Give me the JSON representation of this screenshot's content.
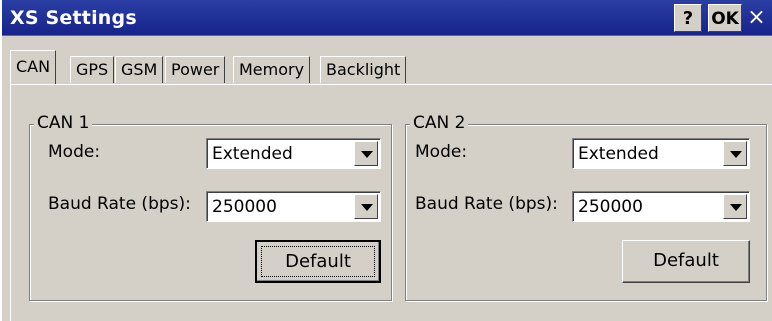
{
  "window": {
    "title": "XS Settings",
    "help_label": "?",
    "ok_label": "OK",
    "close_label": "×"
  },
  "tabs": [
    {
      "label": "CAN",
      "active": true
    },
    {
      "label": "GPS",
      "active": false
    },
    {
      "label": "GSM",
      "active": false
    },
    {
      "label": "Power",
      "active": false
    },
    {
      "label": "Memory",
      "active": false
    },
    {
      "label": "Backlight",
      "active": false
    }
  ],
  "can1": {
    "group_label": "CAN 1",
    "mode_label": "Mode:",
    "mode_value": "Extended",
    "baud_label": "Baud Rate (bps):",
    "baud_value": "250000",
    "default_label": "Default"
  },
  "can2": {
    "group_label": "CAN 2",
    "mode_label": "Mode:",
    "mode_value": "Extended",
    "baud_label": "Baud Rate (bps):",
    "baud_value": "250000",
    "default_label": "Default"
  },
  "colors": {
    "titlebar": "#1a2a93",
    "face": "#d4d0c8"
  }
}
